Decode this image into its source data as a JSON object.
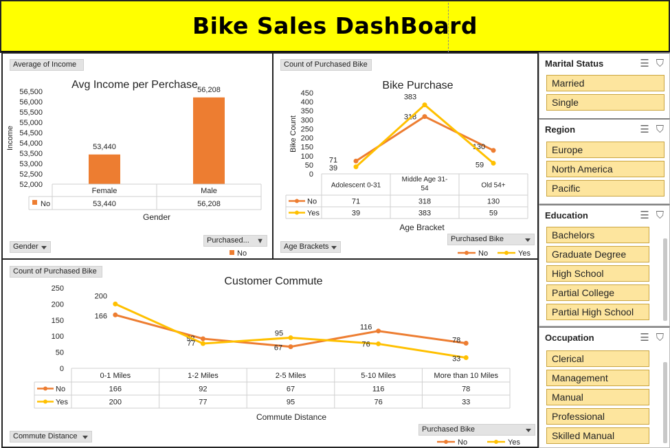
{
  "header": {
    "title": "Bike Sales DashBoard"
  },
  "colors": {
    "no": "#ed7d31",
    "yes": "#ffc000",
    "slicer_item": "#fde59e",
    "title_bg": "#ffff00"
  },
  "income_panel": {
    "field_value": "Average of Income",
    "field_axis": "Gender",
    "field_legend": "Purchased...",
    "legend_item": "No",
    "table_row_label": "No",
    "chart_data": {
      "type": "bar",
      "title": "Avg Income per Perchase",
      "xlabel": "Gender",
      "ylabel": "Income",
      "categories": [
        "Female",
        "Male"
      ],
      "series": [
        {
          "name": "No",
          "values": [
            53440,
            56208
          ]
        }
      ],
      "data_labels": [
        "53,440",
        "56,208"
      ],
      "ylim": [
        52000,
        56500
      ],
      "yticks": [
        "56,500",
        "56,000",
        "55,500",
        "55,000",
        "54,500",
        "54,000",
        "53,500",
        "53,000",
        "52,500",
        "52,000"
      ],
      "grid": false
    }
  },
  "purchase_panel": {
    "field_value": "Count of Purchased Bike",
    "field_axis": "Age Brackets",
    "field_legend": "Purchased Bike",
    "chart_data": {
      "type": "line",
      "title": "Bike Purchase",
      "xlabel": "Age Bracket",
      "ylabel": "Bike Count",
      "categories": [
        "Adolescent 0-31",
        "Middle Age 31-54",
        "Old 54+"
      ],
      "series": [
        {
          "name": "No",
          "values": [
            71,
            318,
            130
          ]
        },
        {
          "name": "Yes",
          "values": [
            39,
            383,
            59
          ]
        }
      ],
      "ylim": [
        0,
        450
      ],
      "yticks": [
        "450",
        "400",
        "350",
        "300",
        "250",
        "200",
        "150",
        "100",
        "50",
        "0"
      ],
      "grid": false
    }
  },
  "commute_panel": {
    "field_value": "Count of Purchased Bike",
    "field_axis": "Commute Distance",
    "field_legend": "Purchased Bike",
    "chart_data": {
      "type": "line",
      "title": "Customer Commute",
      "xlabel": "Commute Distance",
      "categories": [
        "0-1 Miles",
        "1-2 Miles",
        "2-5 Miles",
        "5-10 Miles",
        "More than 10 Miles"
      ],
      "series": [
        {
          "name": "No",
          "values": [
            166,
            92,
            67,
            116,
            78
          ]
        },
        {
          "name": "Yes",
          "values": [
            200,
            77,
            95,
            76,
            33
          ]
        }
      ],
      "ylim": [
        0,
        250
      ],
      "yticks": [
        "250",
        "200",
        "150",
        "100",
        "50",
        "0"
      ],
      "grid": false
    }
  },
  "slicers": {
    "marital": {
      "title": "Marital Status",
      "items": [
        "Married",
        "Single"
      ]
    },
    "region": {
      "title": "Region",
      "items": [
        "Europe",
        "North America",
        "Pacific"
      ]
    },
    "education": {
      "title": "Education",
      "items": [
        "Bachelors",
        "Graduate Degree",
        "High School",
        "Partial College",
        "Partial High School"
      ]
    },
    "occupation": {
      "title": "Occupation",
      "items": [
        "Clerical",
        "Management",
        "Manual",
        "Professional",
        "Skilled Manual"
      ]
    },
    "icons": {
      "multi_select": "multi-select-icon",
      "clear_filter": "clear-filter-icon"
    }
  }
}
